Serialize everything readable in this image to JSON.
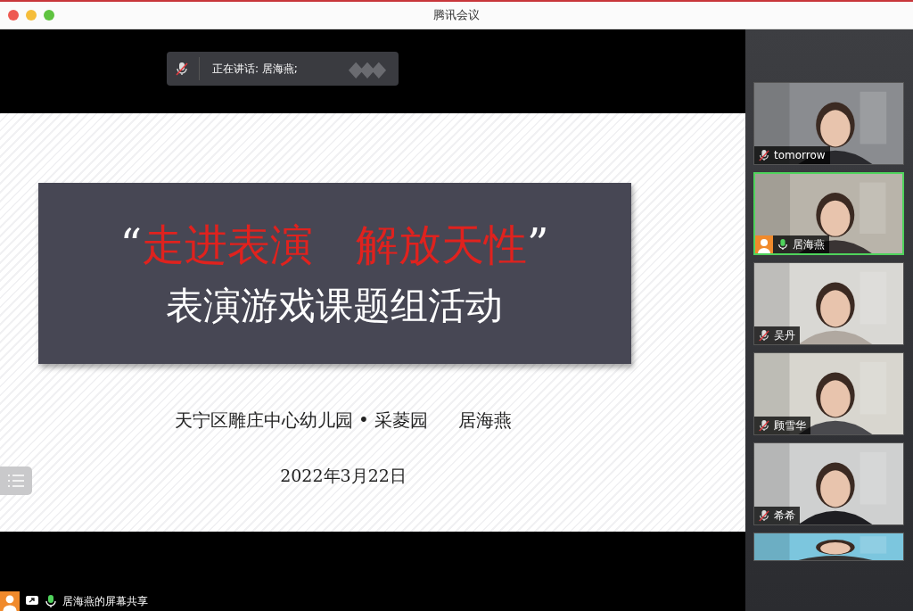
{
  "window": {
    "title": "腾讯会议"
  },
  "speaking_bar": {
    "muted": true,
    "text": "正在讲话: 居海燕;"
  },
  "slide": {
    "quote_open": "“",
    "title": "走进表演　解放天性",
    "quote_close": "”",
    "subtitle": "表演游戏课题组活动",
    "author_line": "天宁区雕庄中心幼儿园 • 采菱园",
    "author": "居海燕",
    "date": "2022年3月22日"
  },
  "share_status": {
    "label": "居海燕的屏幕共享",
    "muted": false
  },
  "participants": [
    {
      "name": "tomorrow",
      "muted": true,
      "speaking": false,
      "host": false
    },
    {
      "name": "居海燕",
      "muted": false,
      "speaking": true,
      "host": true
    },
    {
      "name": "吴丹",
      "muted": true,
      "speaking": false,
      "host": false
    },
    {
      "name": "顾雪华",
      "muted": true,
      "speaking": false,
      "host": false
    },
    {
      "name": "希希",
      "muted": true,
      "speaking": false,
      "host": false
    }
  ]
}
